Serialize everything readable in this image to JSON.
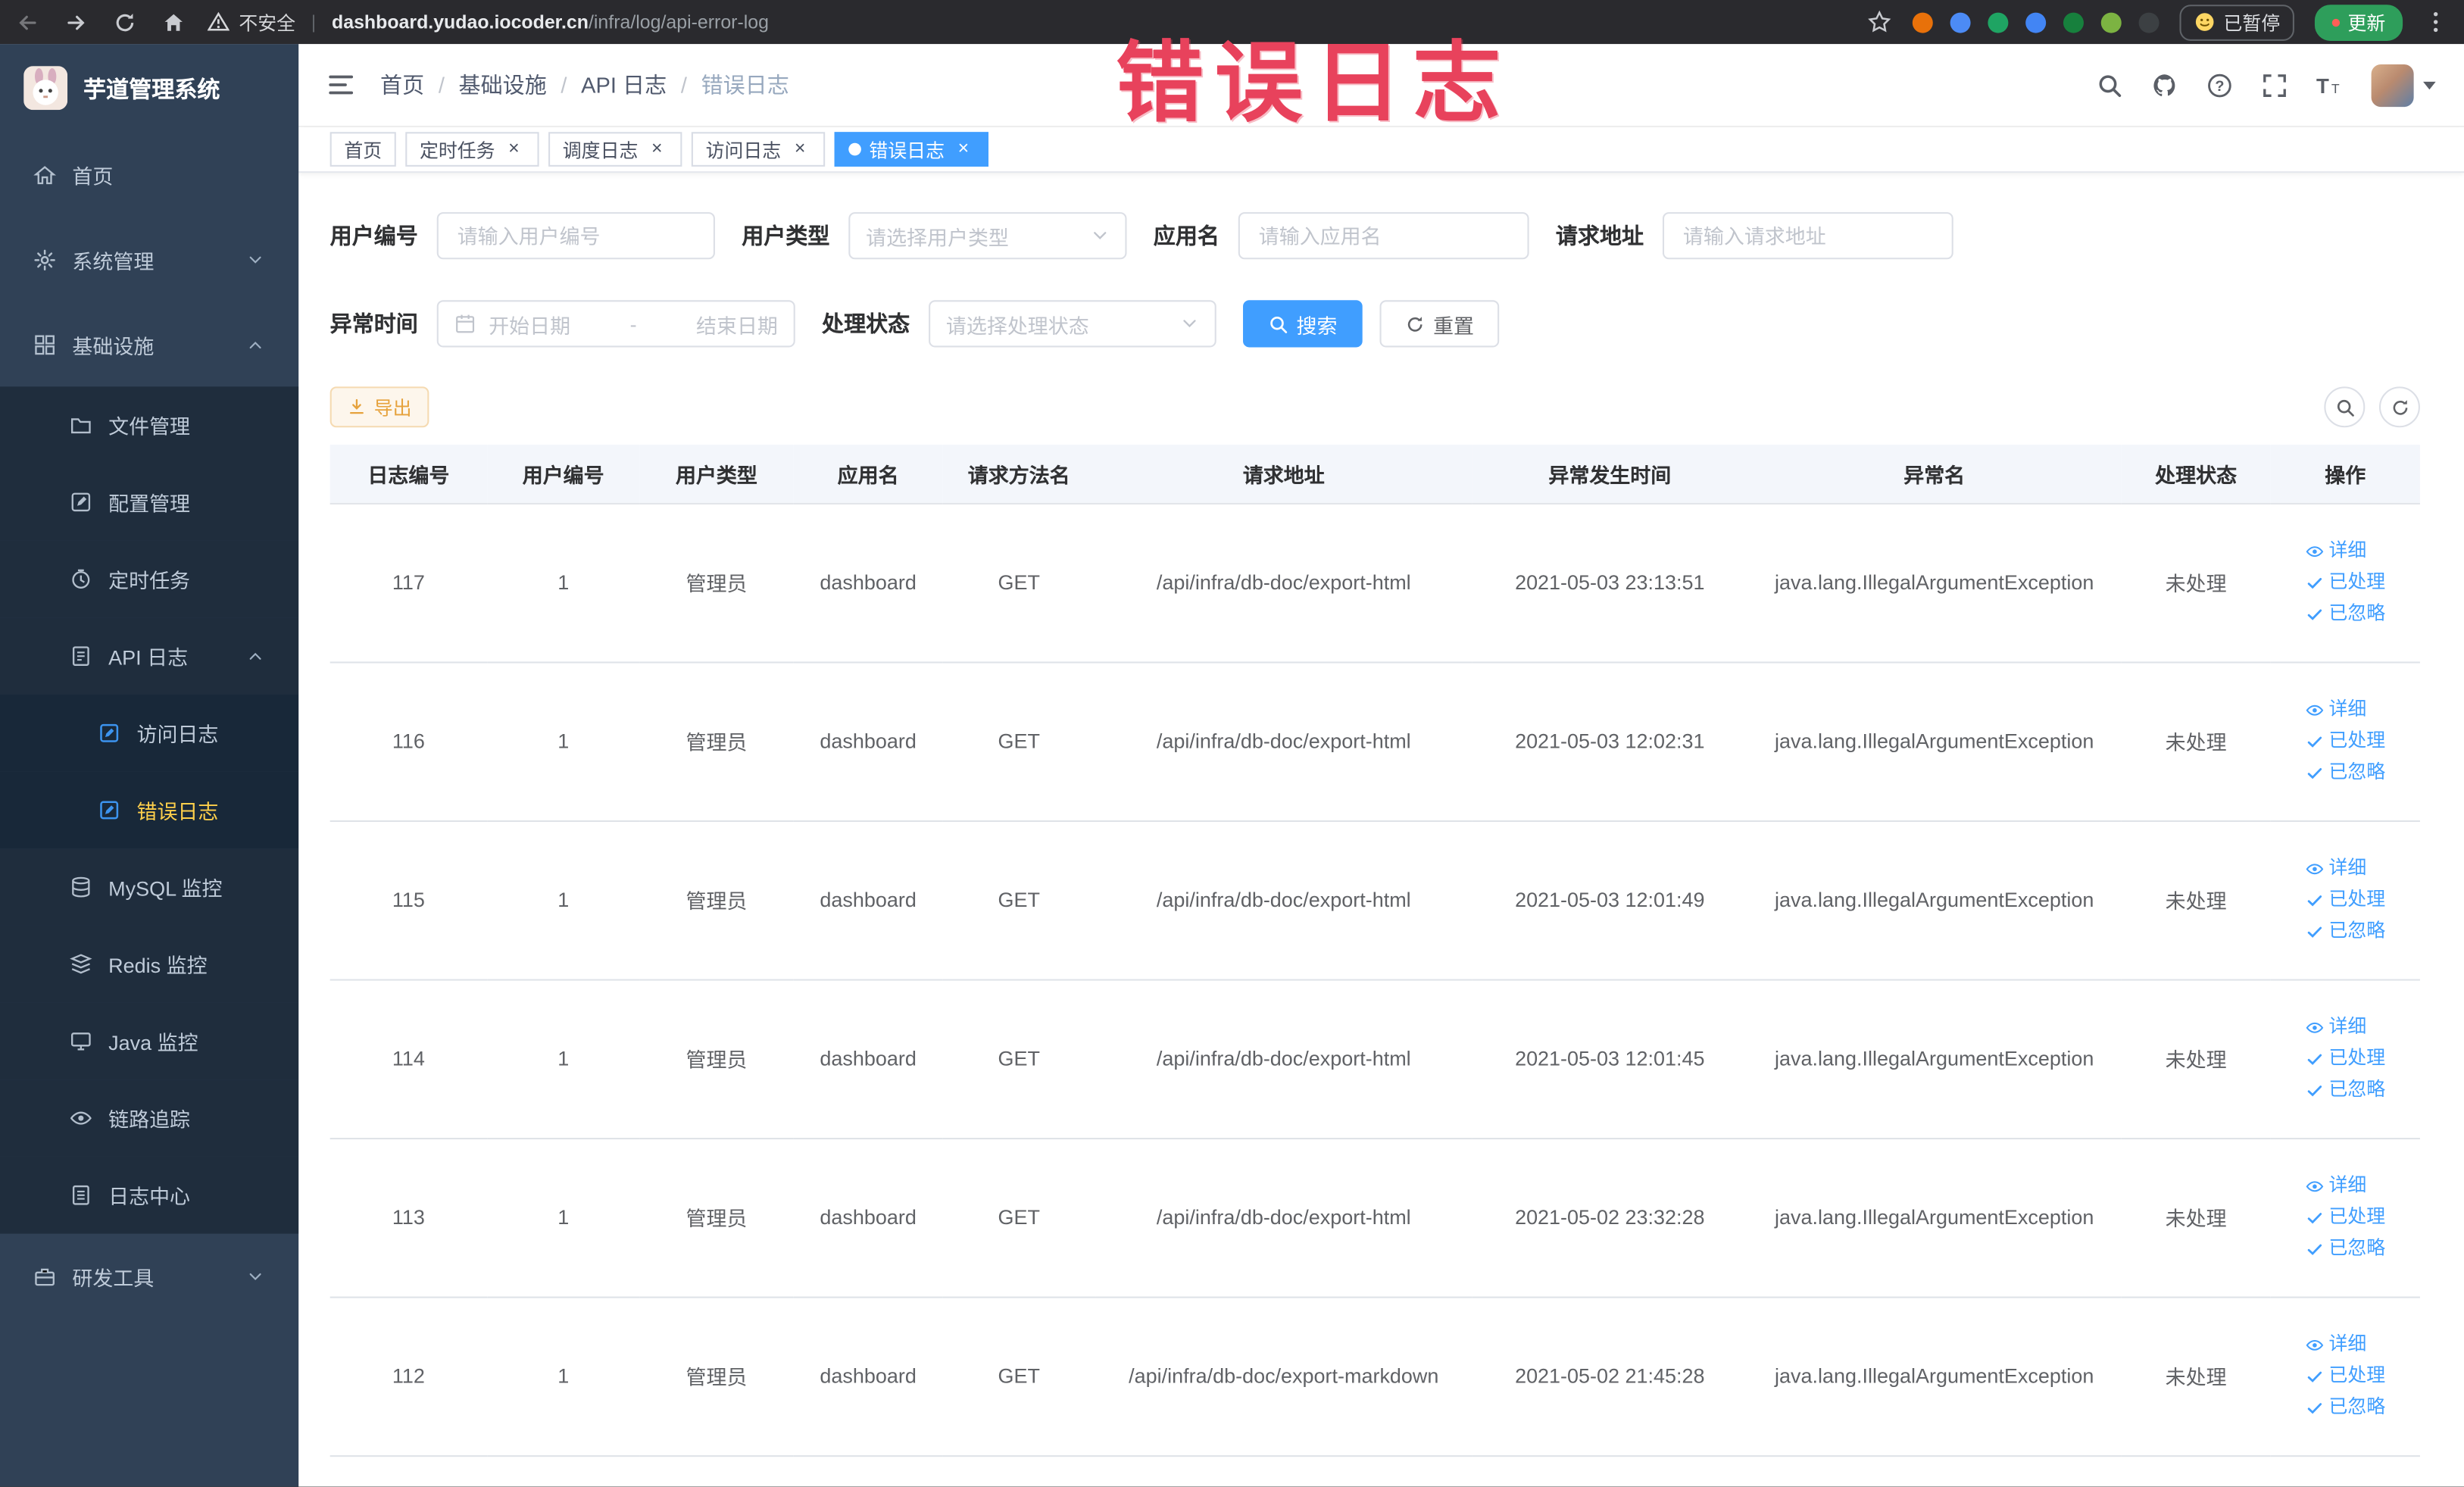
{
  "annotation": {
    "watermark_text": "错误日志"
  },
  "browser": {
    "security_label": "不安全",
    "url_domain": "dashboard.yudao.iocoder.cn",
    "url_path": "/infra/log/api-error-log",
    "paused_badge": "已暂停",
    "update_button": "更新",
    "extension_colors": [
      "#e8710a",
      "#4c8bf5",
      "#1fa463",
      "#4285f4",
      "#17803d",
      "#7cb342",
      "#3c4043"
    ]
  },
  "sidebar": {
    "logo_title": "芋道管理系统",
    "items": [
      {
        "label": "首页",
        "icon": "home-icon",
        "level": 1
      },
      {
        "label": "系统管理",
        "icon": "gear-icon",
        "level": 1,
        "chevron": "down"
      },
      {
        "label": "基础设施",
        "icon": "infra-icon",
        "level": 1,
        "chevron": "up"
      },
      {
        "label": "文件管理",
        "icon": "folder-icon",
        "level": 2
      },
      {
        "label": "配置管理",
        "icon": "config-icon",
        "level": 2
      },
      {
        "label": "定时任务",
        "icon": "timer-icon",
        "level": 2
      },
      {
        "label": "API 日志",
        "icon": "log-icon",
        "level": 2,
        "chevron": "up"
      },
      {
        "label": "访问日志",
        "icon": "doc-icon",
        "level": 3
      },
      {
        "label": "错误日志",
        "icon": "doc-icon",
        "level": 3,
        "active": true
      },
      {
        "label": "MySQL 监控",
        "icon": "database-icon",
        "level": 2
      },
      {
        "label": "Redis 监控",
        "icon": "redis-icon",
        "level": 2
      },
      {
        "label": "Java 监控",
        "icon": "monitor-icon",
        "level": 2
      },
      {
        "label": "链路追踪",
        "icon": "trace-icon",
        "level": 2
      },
      {
        "label": "日志中心",
        "icon": "logcenter-icon",
        "level": 2
      },
      {
        "label": "研发工具",
        "icon": "tools-icon",
        "level": 1,
        "chevron": "down"
      }
    ]
  },
  "navbar": {
    "breadcrumb": [
      "首页",
      "基础设施",
      "API 日志",
      "错误日志"
    ],
    "separator": "/"
  },
  "tags_view": [
    {
      "label": "首页",
      "closable": false,
      "active": false
    },
    {
      "label": "定时任务",
      "closable": true,
      "active": false
    },
    {
      "label": "调度日志",
      "closable": true,
      "active": false
    },
    {
      "label": "访问日志",
      "closable": true,
      "active": false
    },
    {
      "label": "错误日志",
      "closable": true,
      "active": true
    }
  ],
  "filters": {
    "user_id": {
      "label": "用户编号",
      "placeholder": "请输入用户编号"
    },
    "user_type": {
      "label": "用户类型",
      "placeholder": "请选择用户类型"
    },
    "app_name": {
      "label": "应用名",
      "placeholder": "请输入应用名"
    },
    "request_url": {
      "label": "请求地址",
      "placeholder": "请输入请求地址"
    },
    "exception_time": {
      "label": "异常时间",
      "start_placeholder": "开始日期",
      "separator": "-",
      "end_placeholder": "结束日期"
    },
    "process_status": {
      "label": "处理状态",
      "placeholder": "请选择处理状态"
    },
    "search_button": "搜索",
    "reset_button": "重置"
  },
  "toolbar": {
    "export_button": "导出"
  },
  "table": {
    "columns": [
      "日志编号",
      "用户编号",
      "用户类型",
      "应用名",
      "请求方法名",
      "请求地址",
      "异常发生时间",
      "异常名",
      "处理状态",
      "操作"
    ],
    "rows": [
      [
        "117",
        "1",
        "管理员",
        "dashboard",
        "GET",
        "/api/infra/db-doc/export-html",
        "2021-05-03 23:13:51",
        "java.lang.IllegalArgumentException",
        "未处理"
      ],
      [
        "116",
        "1",
        "管理员",
        "dashboard",
        "GET",
        "/api/infra/db-doc/export-html",
        "2021-05-03 12:02:31",
        "java.lang.IllegalArgumentException",
        "未处理"
      ],
      [
        "115",
        "1",
        "管理员",
        "dashboard",
        "GET",
        "/api/infra/db-doc/export-html",
        "2021-05-03 12:01:49",
        "java.lang.IllegalArgumentException",
        "未处理"
      ],
      [
        "114",
        "1",
        "管理员",
        "dashboard",
        "GET",
        "/api/infra/db-doc/export-html",
        "2021-05-03 12:01:45",
        "java.lang.IllegalArgumentException",
        "未处理"
      ],
      [
        "113",
        "1",
        "管理员",
        "dashboard",
        "GET",
        "/api/infra/db-doc/export-html",
        "2021-05-02 23:32:28",
        "java.lang.IllegalArgumentException",
        "未处理"
      ],
      [
        "112",
        "1",
        "管理员",
        "dashboard",
        "GET",
        "/api/infra/db-doc/export-markdown",
        "2021-05-02 21:45:28",
        "java.lang.IllegalArgumentException",
        "未处理"
      ]
    ],
    "row_actions": [
      {
        "label": "详细",
        "icon": "eye-icon"
      },
      {
        "label": "已处理",
        "icon": "check-icon"
      },
      {
        "label": "已忽略",
        "icon": "check-icon"
      }
    ]
  },
  "icons": {
    "search-icon": "magnifier",
    "github-icon": "octocat-disc",
    "question-icon": "circled-question",
    "fullscreen-icon": "expand-corners",
    "fontsize-icon": "large-T-small-T",
    "hamburger-icon": "menu-lines",
    "eye-icon": "eye",
    "check-icon": "checkmark",
    "refresh-icon": "circular-arrow",
    "download-icon": "arrow-down-tray",
    "calendar-icon": "calendar",
    "star-icon": "star-outline",
    "warning-icon": "triangle-exclamation",
    "smiley-icon": "smiley-face",
    "kebab-icon": "three-dots-vertical"
  },
  "colors": {
    "accent": "#409EFF",
    "sidebar_active": "#ffd04b",
    "warning_text": "#e6a23c"
  }
}
